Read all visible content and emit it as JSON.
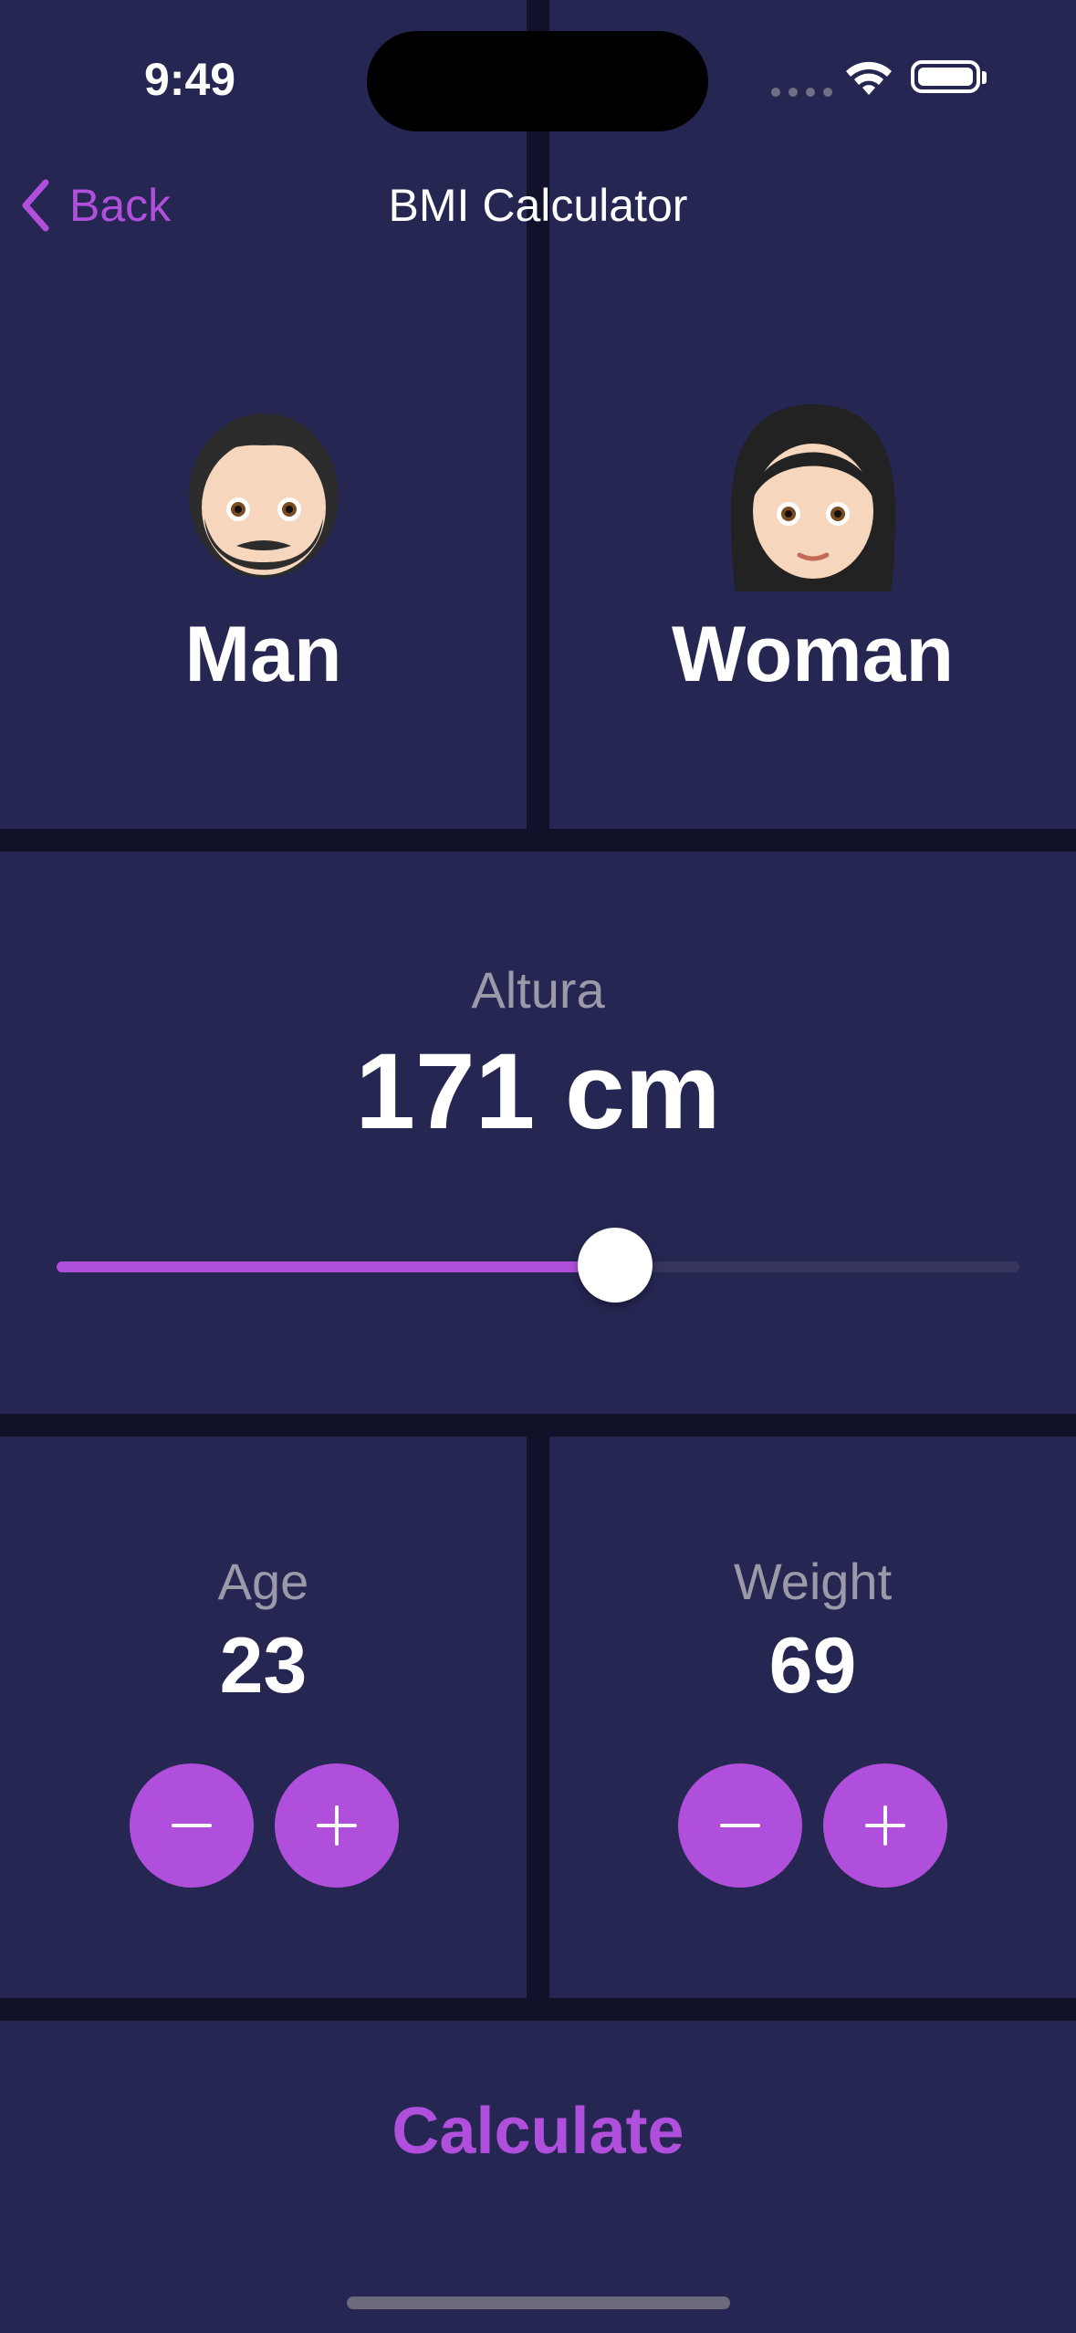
{
  "status": {
    "time": "9:49"
  },
  "nav": {
    "back_label": "Back",
    "title": "BMI Calculator"
  },
  "gender": {
    "man": {
      "label": "Man",
      "icon": "man-emoji-icon"
    },
    "woman": {
      "label": "Woman",
      "icon": "woman-emoji-icon"
    }
  },
  "height": {
    "label": "Altura",
    "value_text": "171 cm",
    "slider_fraction": 0.58
  },
  "age": {
    "label": "Age",
    "value": "23"
  },
  "weight": {
    "label": "Weight",
    "value": "69"
  },
  "actions": {
    "calculate_label": "Calculate"
  },
  "colors": {
    "accent": "#b04fdb",
    "panel": "#262653",
    "background": "#11112a"
  }
}
